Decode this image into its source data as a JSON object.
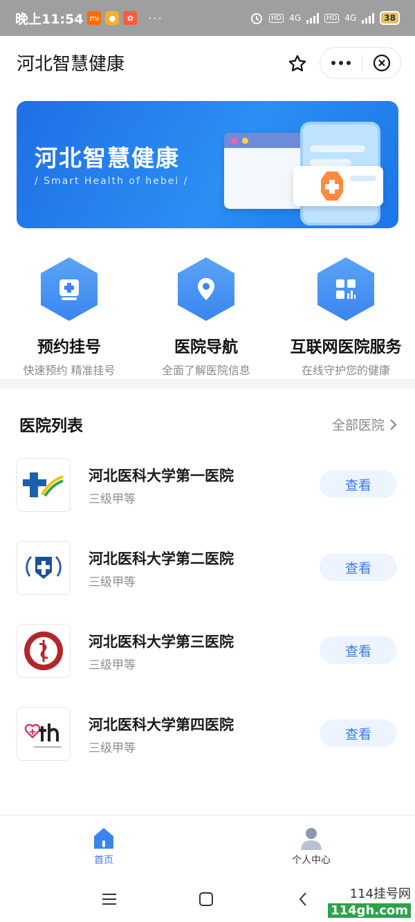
{
  "status_bar": {
    "time": "晚上11:54",
    "battery": "38",
    "hd1": "HD",
    "hd2": "HD",
    "net1": "4G",
    "net2": "4G",
    "dots": "···"
  },
  "title_bar": {
    "title": "河北智慧健康"
  },
  "banner": {
    "title": "河北智慧健康",
    "subtitle": "/ Smart Health of hebei /"
  },
  "quick_entries": [
    {
      "label": "预约挂号",
      "desc": "快速预约 精准挂号",
      "icon": "medical-case-icon"
    },
    {
      "label": "医院导航",
      "desc": "全面了解医院信息",
      "icon": "location-pin-icon"
    },
    {
      "label": "互联网医院服务",
      "desc": "在线守护您的健康",
      "icon": "grid-apps-icon"
    }
  ],
  "hospital_list": {
    "title": "医院列表",
    "all_link": "全部医院",
    "items": [
      {
        "name": "河北医科大学第一医院",
        "level": "三级甲等",
        "button": "查看"
      },
      {
        "name": "河北医科大学第二医院",
        "level": "三级甲等",
        "button": "查看"
      },
      {
        "name": "河北医科大学第三医院",
        "level": "三级甲等",
        "button": "查看"
      },
      {
        "name": "河北医科大学第四医院",
        "level": "三级甲等",
        "button": "查看"
      }
    ]
  },
  "tab_bar": {
    "home": "首页",
    "profile": "个人中心"
  },
  "watermark": {
    "line1": "114挂号网",
    "line2": "114gh.com"
  },
  "colors": {
    "accent": "#3a7be8",
    "banner": "#1f6fe6"
  }
}
